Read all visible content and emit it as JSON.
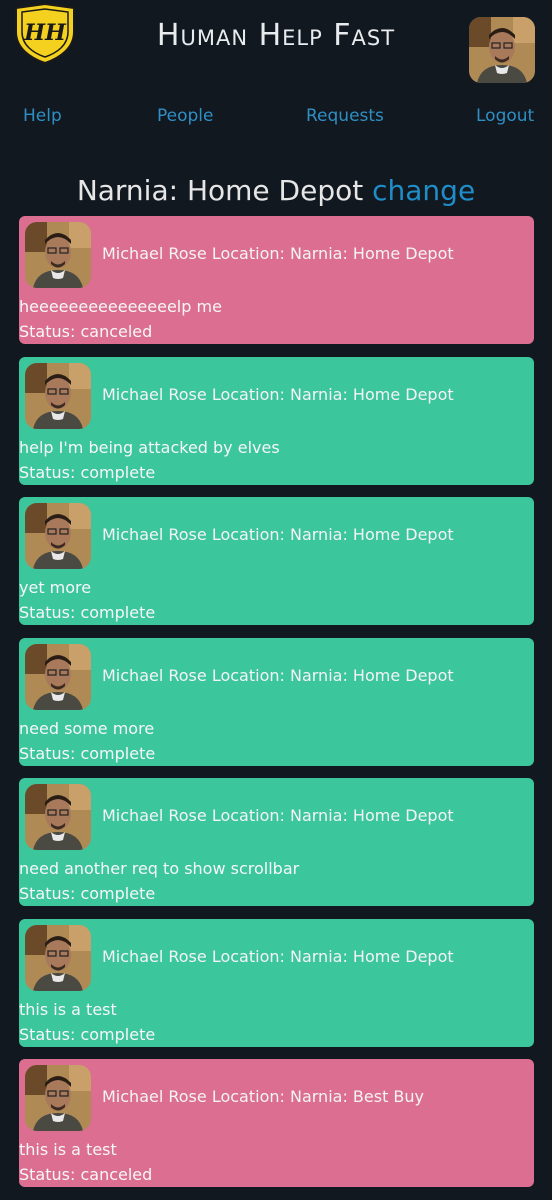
{
  "header": {
    "title": "Human Help Fast",
    "logo_text": "HH",
    "logo_icon": "shield-logo-icon",
    "avatar_icon": "user-avatar"
  },
  "nav": {
    "items": [
      {
        "label": "Help"
      },
      {
        "label": "People"
      },
      {
        "label": "Requests"
      },
      {
        "label": "Logout"
      }
    ]
  },
  "location": {
    "name": "Narnia: Home Depot",
    "change_label": "change"
  },
  "colors": {
    "background": "#121820",
    "canceled": "#dc6f91",
    "complete": "#3cc69c",
    "link": "#2f8fc4",
    "logo_yellow": "#f4d11e"
  },
  "requests": [
    {
      "requester": "Michael Rose",
      "location": "Location: Narnia: Home Depot",
      "message": "heeeeeeeeeeeeeeelp me",
      "status": "Status: canceled",
      "state": "canceled"
    },
    {
      "requester": "Michael Rose",
      "location": "Location: Narnia: Home Depot",
      "message": "help I'm being attacked by elves",
      "status": "Status: complete",
      "state": "complete"
    },
    {
      "requester": "Michael Rose",
      "location": "Location: Narnia: Home Depot",
      "message": "yet more",
      "status": "Status: complete",
      "state": "complete"
    },
    {
      "requester": "Michael Rose",
      "location": "Location: Narnia: Home Depot",
      "message": "need some more",
      "status": "Status: complete",
      "state": "complete"
    },
    {
      "requester": "Michael Rose",
      "location": "Location: Narnia: Home Depot",
      "message": "need another req to show scrollbar",
      "status": "Status: complete",
      "state": "complete"
    },
    {
      "requester": "Michael Rose",
      "location": "Location: Narnia: Home Depot",
      "message": "this is a test",
      "status": "Status: complete",
      "state": "complete"
    },
    {
      "requester": "Michael Rose",
      "location": "Location: Narnia: Best Buy",
      "message": "this is a test",
      "status": "Status: canceled",
      "state": "canceled"
    }
  ]
}
